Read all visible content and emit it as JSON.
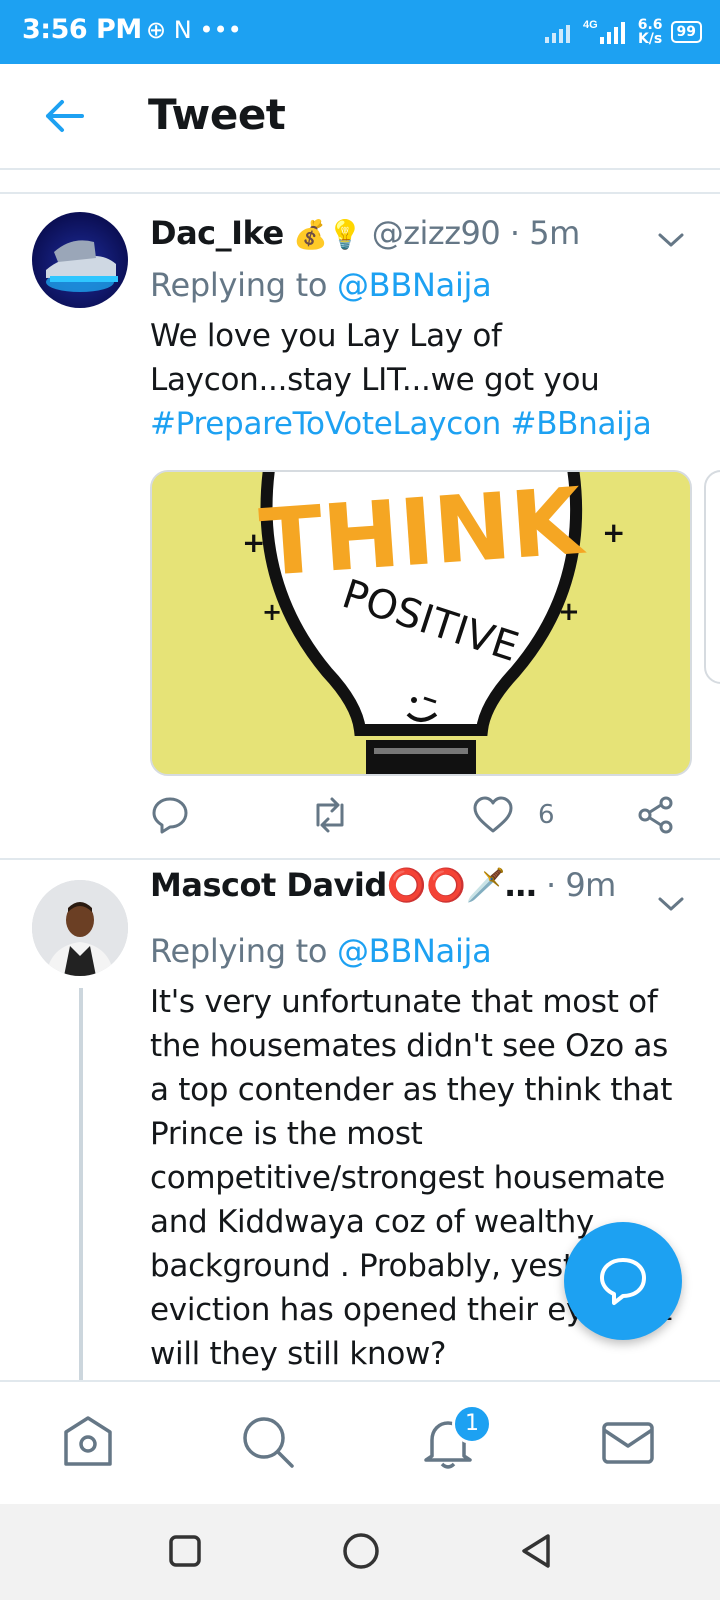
{
  "status_bar": {
    "time": "3:56 PM",
    "left_icons": "⊕ N •••",
    "speed_value": "6.6",
    "speed_unit": "K/s",
    "battery": "99",
    "network": "4G"
  },
  "header": {
    "title": "Tweet",
    "back_icon": "arrow-left-icon"
  },
  "tweets": [
    {
      "display_name": "Dac_Ike",
      "emojis": "💰💡",
      "handle": "@zizz90",
      "time": "5m",
      "replying_prefix": "Replying to",
      "replying_to": "@BBNaija",
      "text_lines": [
        "We love you Lay Lay of",
        "Laycon...stay LIT...we got you"
      ],
      "hashtags": "#PrepareToVoteLaycon #BBnaija",
      "image": {
        "top_text": "THINK",
        "bottom_text": "POSITIVE",
        "background": "#e6e377"
      },
      "like_count": "6"
    },
    {
      "display_name": "Mascot David⭕⭕🗡️…",
      "handle": "",
      "time": "9m",
      "replying_prefix": "Replying to",
      "replying_to": "@BBNaija",
      "text_lines": [
        "It's very unfortunate that most of",
        "the housemates didn't see Ozo as",
        "a top contender as they think that",
        "Prince is the most",
        "competitive/strongest housemate",
        "and Kiddwaya coz of wealthy",
        "background . Probably, yest",
        "eviction has opened their ey      at",
        "will they still know?"
      ]
    }
  ],
  "bottom_nav": {
    "items": [
      "home-icon",
      "search-icon",
      "notifications-icon",
      "messages-icon"
    ],
    "notification_badge": "1"
  },
  "colors": {
    "accent": "#1da1f2",
    "muted": "#657786",
    "text": "#14171a"
  }
}
